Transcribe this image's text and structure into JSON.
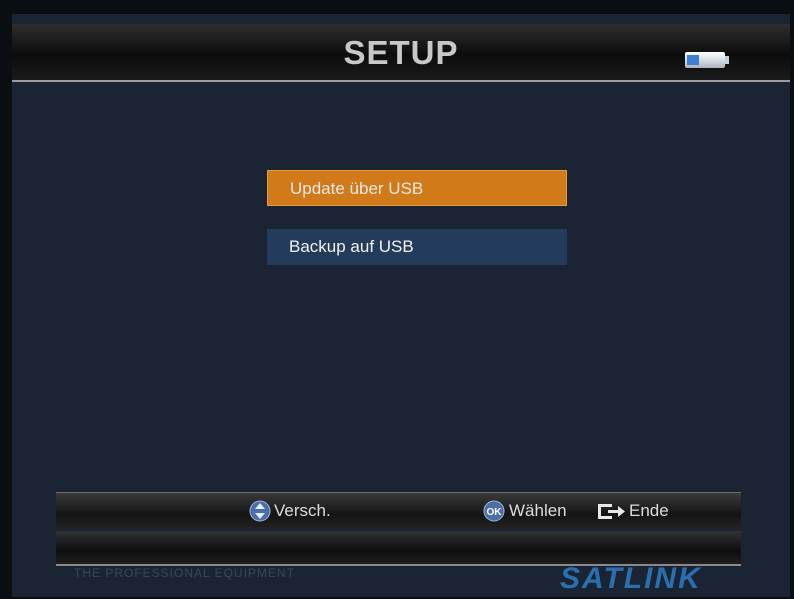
{
  "header": {
    "title": "SETUP",
    "usb_icon": "usb-stick-icon"
  },
  "menu": {
    "items": [
      {
        "label": "Update über USB",
        "selected": true
      },
      {
        "label": "Backup auf USB",
        "selected": false
      }
    ]
  },
  "help_bar": {
    "move": {
      "icon": "up-down-arrows-icon",
      "label": "Versch."
    },
    "select": {
      "icon": "ok-button-icon",
      "label": "Wählen"
    },
    "exit": {
      "icon": "exit-icon",
      "label": "Ende"
    }
  },
  "footer": {
    "tagline": "THE PROFESSIONAL EQUIPMENT",
    "brand": "SATLINK"
  },
  "colors": {
    "background": "#1a2433",
    "selected": "#d17a1a",
    "item": "#243c5c",
    "brand": "#2a6fb0"
  }
}
